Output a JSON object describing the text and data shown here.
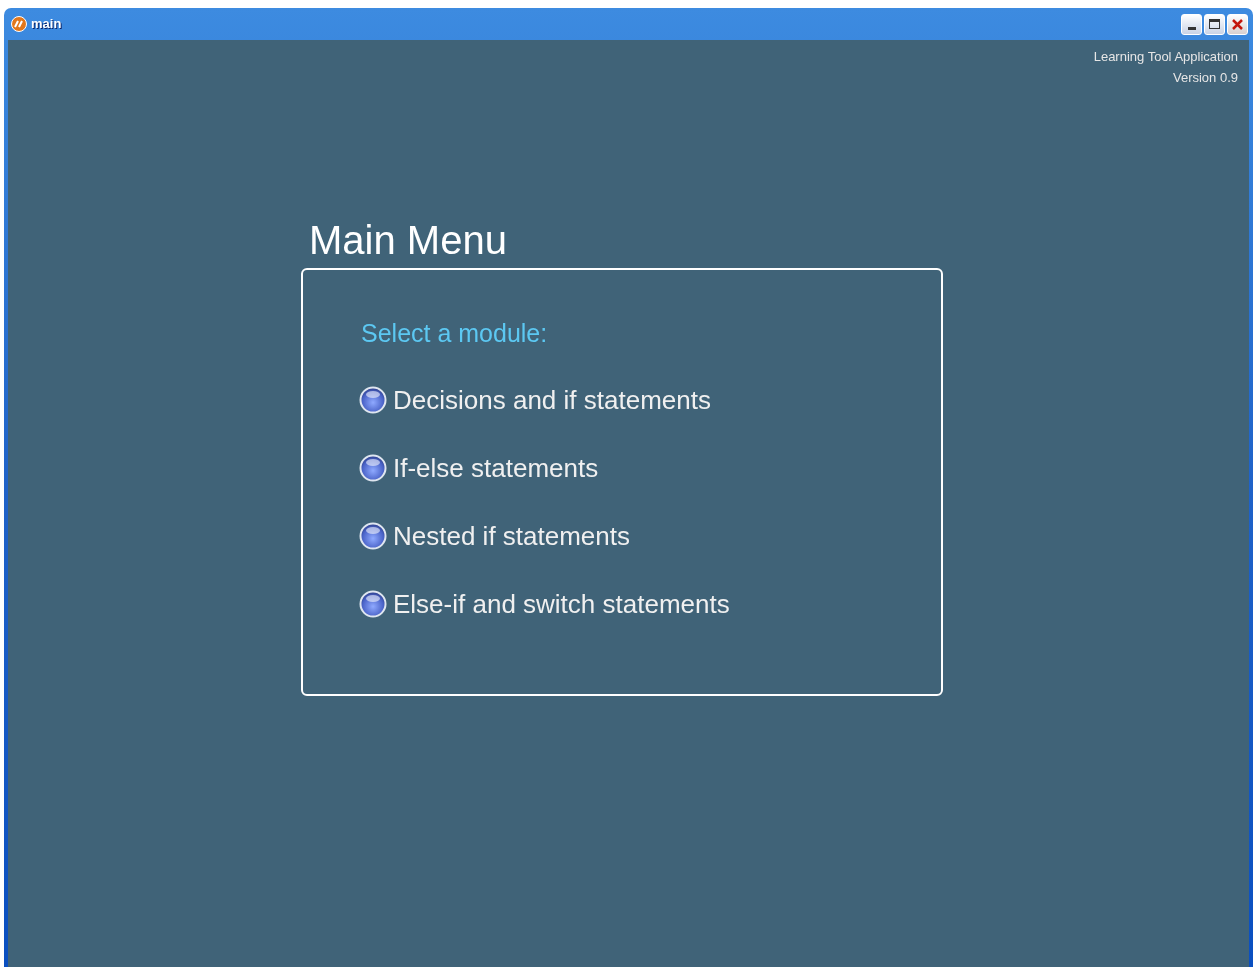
{
  "window": {
    "title": "main"
  },
  "app_info": [
    "Learning Tool Application",
    "Version 0.9"
  ],
  "menu": {
    "title": "Main Menu",
    "prompt": "Select a module:",
    "options": [
      {
        "label": "Decisions and if statements",
        "selected": false
      },
      {
        "label": "If-else statements",
        "selected": false
      },
      {
        "label": "Nested if statements",
        "selected": false
      },
      {
        "label": "Else-if and switch statements",
        "selected": false
      }
    ]
  }
}
